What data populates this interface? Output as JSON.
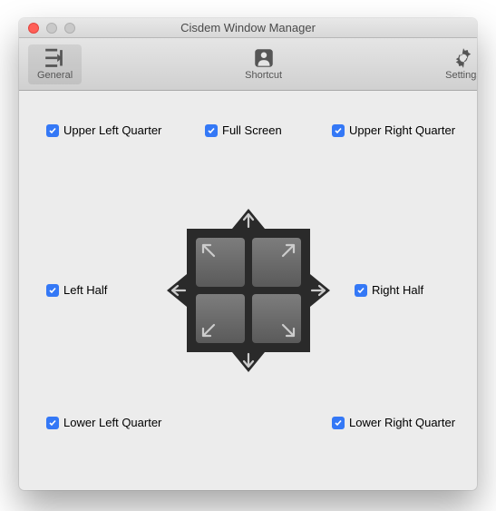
{
  "window": {
    "title": "Cisdem Window Manager"
  },
  "tabs": {
    "general": "General",
    "shortcut": "Shortcut",
    "settings": "Settings"
  },
  "options": {
    "upper_left": "Upper Left Quarter",
    "full_screen": "Full Screen",
    "upper_right": "Upper Right Quarter",
    "left_half": "Left Half",
    "right_half": "Right Half",
    "lower_left": "Lower Left Quarter",
    "lower_right": "Lower Right Quarter"
  },
  "colors": {
    "accent": "#3478f6"
  }
}
